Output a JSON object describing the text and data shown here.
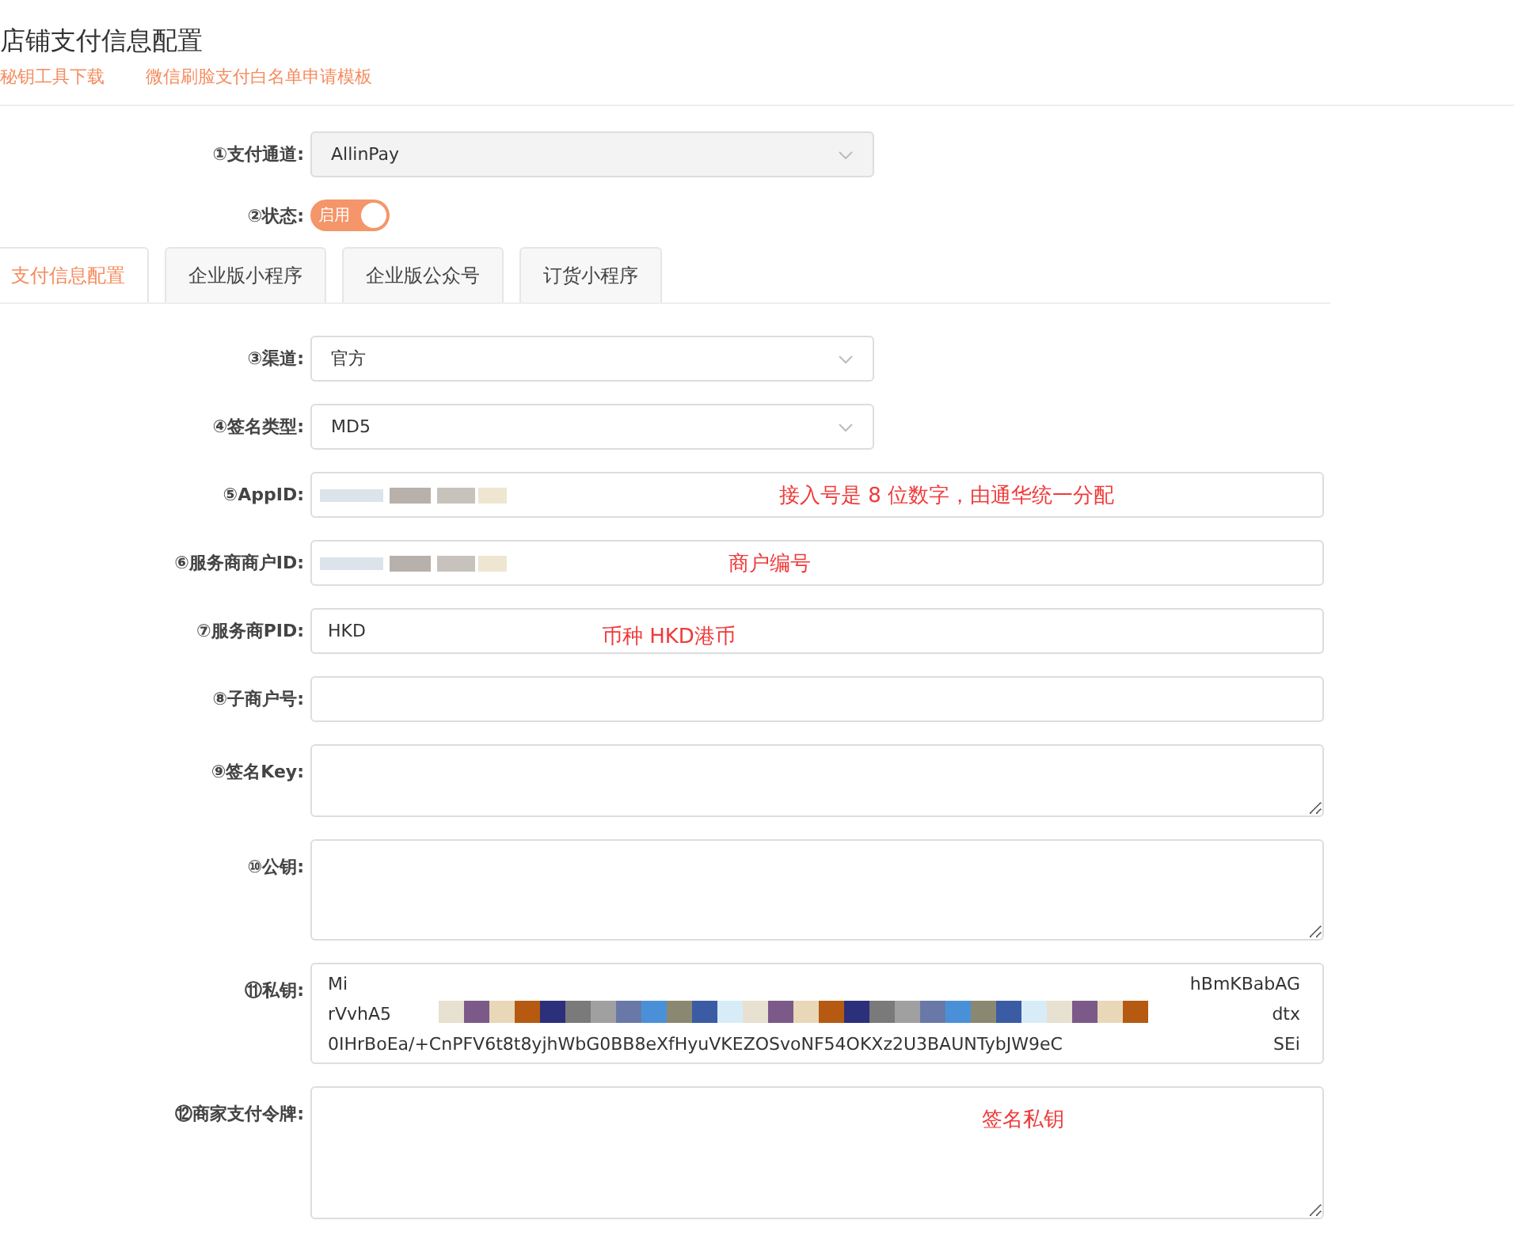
{
  "page": {
    "title": "店铺支付信息配置",
    "links": [
      "秘钥工具下载",
      "微信刷脸支付白名单申请模板"
    ]
  },
  "channel": {
    "label": "①支付通道:",
    "value": "AllinPay",
    "disabled": true
  },
  "status": {
    "label": "②状态:",
    "text": "启用",
    "on": true
  },
  "tabs": [
    {
      "label": "支付信息配置",
      "selected": true
    },
    {
      "label": "企业版小程序",
      "selected": false
    },
    {
      "label": "企业版公众号",
      "selected": false
    },
    {
      "label": "订货小程序",
      "selected": false
    }
  ],
  "fields": [
    {
      "kind": "select",
      "label": "③渠道:",
      "value": "官方"
    },
    {
      "kind": "select",
      "label": "④签名类型:",
      "value": "MD5"
    },
    {
      "kind": "input",
      "label": "⑤AppID:",
      "redacted": true,
      "note": "接入号是 8 位数字，由通华统一分配"
    },
    {
      "kind": "input",
      "label": "⑥服务商商户ID:",
      "redacted": true,
      "note": "商户编号"
    },
    {
      "kind": "input",
      "label": "⑦服务商PID:",
      "value": "HKD",
      "note": "币种  HKD港币"
    },
    {
      "kind": "input",
      "label": "⑧子商户号:"
    },
    {
      "kind": "textarea",
      "label": "⑨签名Key:"
    },
    {
      "kind": "textarea",
      "label": "⑩公钥:"
    },
    {
      "kind": "key",
      "label": "⑪私钥:",
      "lines": [
        {
          "left": "Mi",
          "right": "hBmKBabAG"
        },
        {
          "left": "rVvhA5",
          "right": "dtx"
        },
        {
          "left": "0IHrBoEa/+CnPFV6t8t8yjhWbG0BB8eXfHyuVKEZOSvoNF54OKXz2U3BAUNTybJW9eC",
          "right": "SEi"
        }
      ]
    },
    {
      "kind": "textarea",
      "label": "⑫商家支付令牌:",
      "note": "签名私钥"
    }
  ]
}
